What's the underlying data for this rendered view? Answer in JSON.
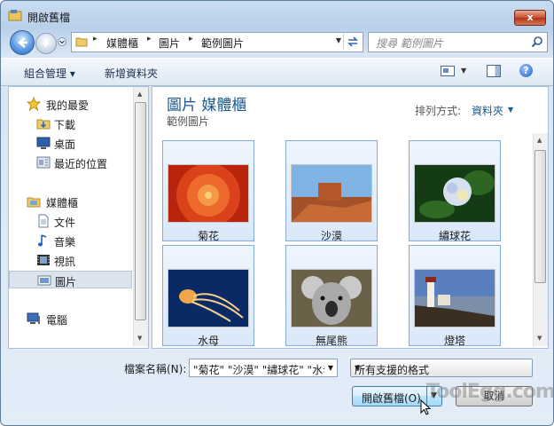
{
  "window": {
    "title": "開啟舊檔",
    "close_symbol": "x"
  },
  "address_bar": {
    "crumbs": [
      "媒體櫃",
      "圖片",
      "範例圖片"
    ],
    "separator": "▸"
  },
  "search": {
    "placeholder": "搜尋 範例圖片"
  },
  "toolbar": {
    "organize": "組合管理 ▾",
    "new_folder": "新增資料夾",
    "help": "?"
  },
  "nav": {
    "items": [
      {
        "label": "我的最愛",
        "icon": "star-icon"
      },
      {
        "label": "下載",
        "icon": "download-folder-icon"
      },
      {
        "label": "桌面",
        "icon": "desktop-icon"
      },
      {
        "label": "最近的位置",
        "icon": "recent-places-icon"
      },
      {
        "label": "媒體櫃",
        "icon": "library-icon"
      },
      {
        "label": "文件",
        "icon": "documents-icon"
      },
      {
        "label": "音樂",
        "icon": "music-icon"
      },
      {
        "label": "視訊",
        "icon": "video-icon"
      },
      {
        "label": "圖片",
        "icon": "pictures-icon",
        "selected": true
      },
      {
        "label": "電腦",
        "icon": "computer-icon"
      }
    ]
  },
  "content": {
    "library_title": "圖片 媒體櫃",
    "library_subtitle": "範例圖片",
    "arrange_label": "排列方式:",
    "arrange_value": "資料夾",
    "files": [
      {
        "name": "菊花",
        "thumb": "chrysanthemum"
      },
      {
        "name": "沙漠",
        "thumb": "desert"
      },
      {
        "name": "繡球花",
        "thumb": "hydrangeas"
      },
      {
        "name": "水母",
        "thumb": "jellyfish"
      },
      {
        "name": "無尾熊",
        "thumb": "koala"
      },
      {
        "name": "燈塔",
        "thumb": "lighthouse"
      }
    ]
  },
  "bottom": {
    "filename_label": "檔案名稱(N):",
    "filename_value": "\"菊花\" \"沙漠\" \"繡球花\" \"水母\"",
    "filter_value": "所有支援的格式",
    "open_button": "開啟舊檔(O)",
    "cancel_button": "取消"
  },
  "watermark": "ToolEgg.com"
}
